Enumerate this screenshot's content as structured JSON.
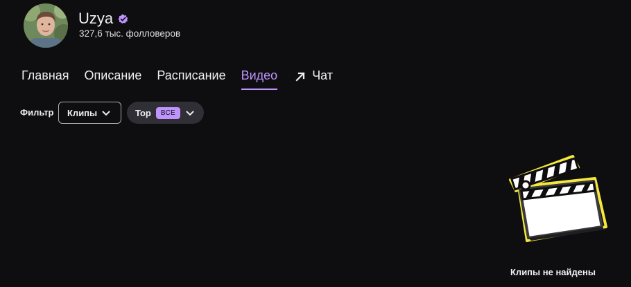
{
  "channel": {
    "name": "Uzya",
    "followers": "327,6 тыс. фолловеров",
    "verified": true
  },
  "tabs": [
    {
      "label": "Главная",
      "active": false
    },
    {
      "label": "Описание",
      "active": false
    },
    {
      "label": "Расписание",
      "active": false
    },
    {
      "label": "Видео",
      "active": true
    },
    {
      "label": "Чат",
      "active": false,
      "icon": "external-arrow-icon"
    }
  ],
  "filters": {
    "label": "Фильтр",
    "type_dropdown": {
      "value": "Клипы"
    },
    "sort_dropdown": {
      "value": "Top",
      "badge": "ВСЕ"
    }
  },
  "empty_state": {
    "message": "Клипы не найдены",
    "icon": "clapperboard-icon"
  },
  "colors": {
    "background": "#0e0e10",
    "accent": "#bf94ff",
    "text": "#efeff1",
    "illustration_outline": "#f5e83c"
  }
}
